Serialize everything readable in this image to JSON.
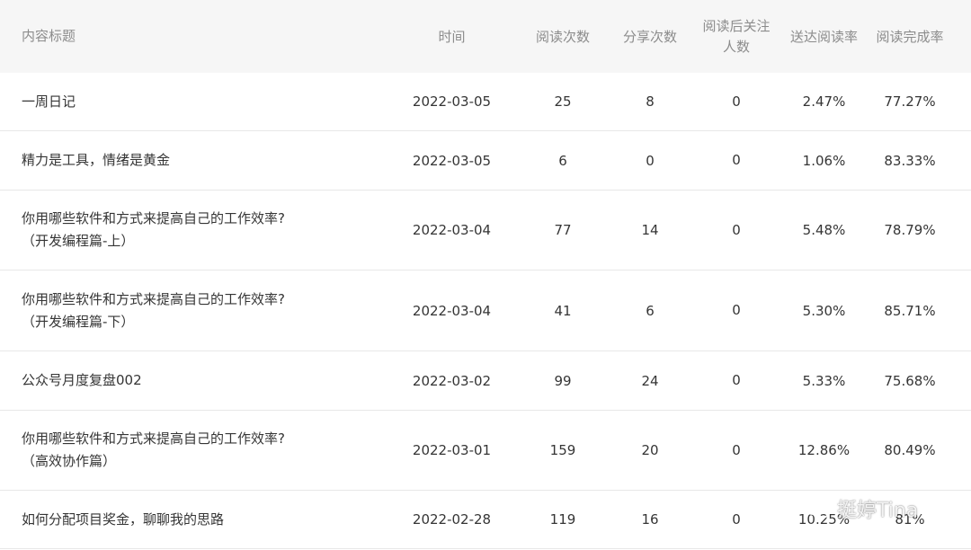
{
  "header": {
    "title": "内容标题",
    "date": "时间",
    "reads": "阅读次数",
    "shares": "分享次数",
    "follows": "阅读后关注人数",
    "reach_rate": "送达阅读率",
    "completion_rate": "阅读完成率"
  },
  "rows": [
    {
      "title": "一周日记",
      "date": "2022-03-05",
      "reads": "25",
      "shares": "8",
      "follows": "0",
      "reach_rate": "2.47%",
      "completion_rate": "77.27%"
    },
    {
      "title": "精力是工具，情绪是黄金",
      "date": "2022-03-05",
      "reads": "6",
      "shares": "0",
      "follows": "0",
      "reach_rate": "1.06%",
      "completion_rate": "83.33%"
    },
    {
      "title": "你用哪些软件和方式来提高自己的工作效率?（开发编程篇-上）",
      "date": "2022-03-04",
      "reads": "77",
      "shares": "14",
      "follows": "0",
      "reach_rate": "5.48%",
      "completion_rate": "78.79%"
    },
    {
      "title": "你用哪些软件和方式来提高自己的工作效率?（开发编程篇-下）",
      "date": "2022-03-04",
      "reads": "41",
      "shares": "6",
      "follows": "0",
      "reach_rate": "5.30%",
      "completion_rate": "85.71%"
    },
    {
      "title": "公众号月度复盘002",
      "date": "2022-03-02",
      "reads": "99",
      "shares": "24",
      "follows": "0",
      "reach_rate": "5.33%",
      "completion_rate": "75.68%"
    },
    {
      "title": "你用哪些软件和方式来提高自己的工作效率?（高效协作篇）",
      "date": "2022-03-01",
      "reads": "159",
      "shares": "20",
      "follows": "0",
      "reach_rate": "12.86%",
      "completion_rate": "80.49%"
    },
    {
      "title": "如何分配项目奖金，聊聊我的思路",
      "date": "2022-02-28",
      "reads": "119",
      "shares": "16",
      "follows": "0",
      "reach_rate": "10.25%",
      "completion_rate": "81%"
    }
  ],
  "watermark": {
    "icon": "wechat-icon",
    "text": "挺婷Tina"
  }
}
